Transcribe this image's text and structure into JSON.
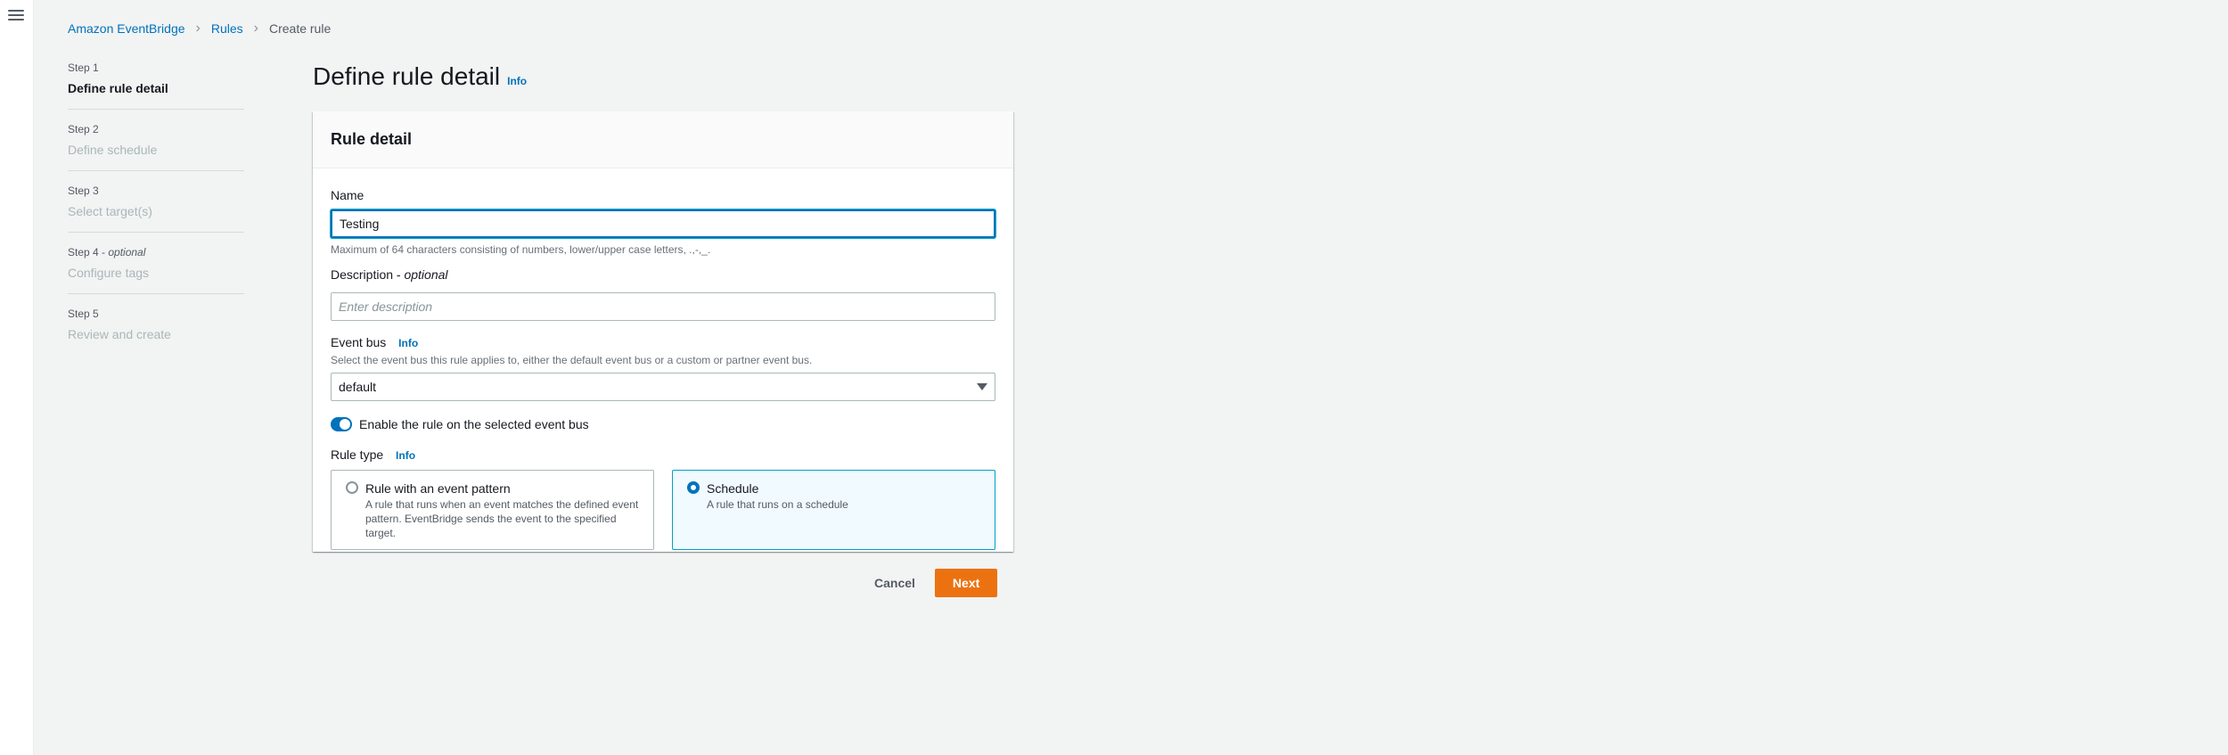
{
  "breadcrumb": {
    "root": "Amazon EventBridge",
    "rules": "Rules",
    "current": "Create rule"
  },
  "steps": [
    {
      "number": "Step 1",
      "title": "Define rule detail",
      "active": true
    },
    {
      "number": "Step 2",
      "title": "Define schedule"
    },
    {
      "number": "Step 3",
      "title": "Select target(s)"
    },
    {
      "number": "Step 4 - ",
      "optional": "optional",
      "title": "Configure tags"
    },
    {
      "number": "Step 5",
      "title": "Review and create"
    }
  ],
  "page": {
    "title": "Define rule detail",
    "info": "Info"
  },
  "card": {
    "title": "Rule detail",
    "name": {
      "label": "Name",
      "value": "Testing",
      "hint": "Maximum of 64 characters consisting of numbers, lower/upper case letters, .,-,_."
    },
    "description": {
      "label": "Description - ",
      "optional": "optional",
      "placeholder": "Enter description",
      "value": ""
    },
    "event_bus": {
      "label": "Event bus",
      "info": "Info",
      "hint": "Select the event bus this rule applies to, either the default event bus or a custom or partner event bus.",
      "selected": "default"
    },
    "toggle": {
      "label": "Enable the rule on the selected event bus",
      "on": true
    },
    "rule_type": {
      "label": "Rule type",
      "info": "Info",
      "options": [
        {
          "title": "Rule with an event pattern",
          "desc": "A rule that runs when an event matches the defined event pattern. EventBridge sends the event to the specified target.",
          "selected": false
        },
        {
          "title": "Schedule",
          "desc": "A rule that runs on a schedule",
          "selected": true
        }
      ]
    }
  },
  "actions": {
    "cancel": "Cancel",
    "next": "Next"
  },
  "colors": {
    "primary_button": "#ec7211",
    "link": "#0073bb",
    "background": "#f2f3f3"
  },
  "icons": {
    "menu": "hamburger-menu-icon",
    "breadcrumb_separator": "chevron-right-icon",
    "select_caret": "caret-down-icon"
  }
}
